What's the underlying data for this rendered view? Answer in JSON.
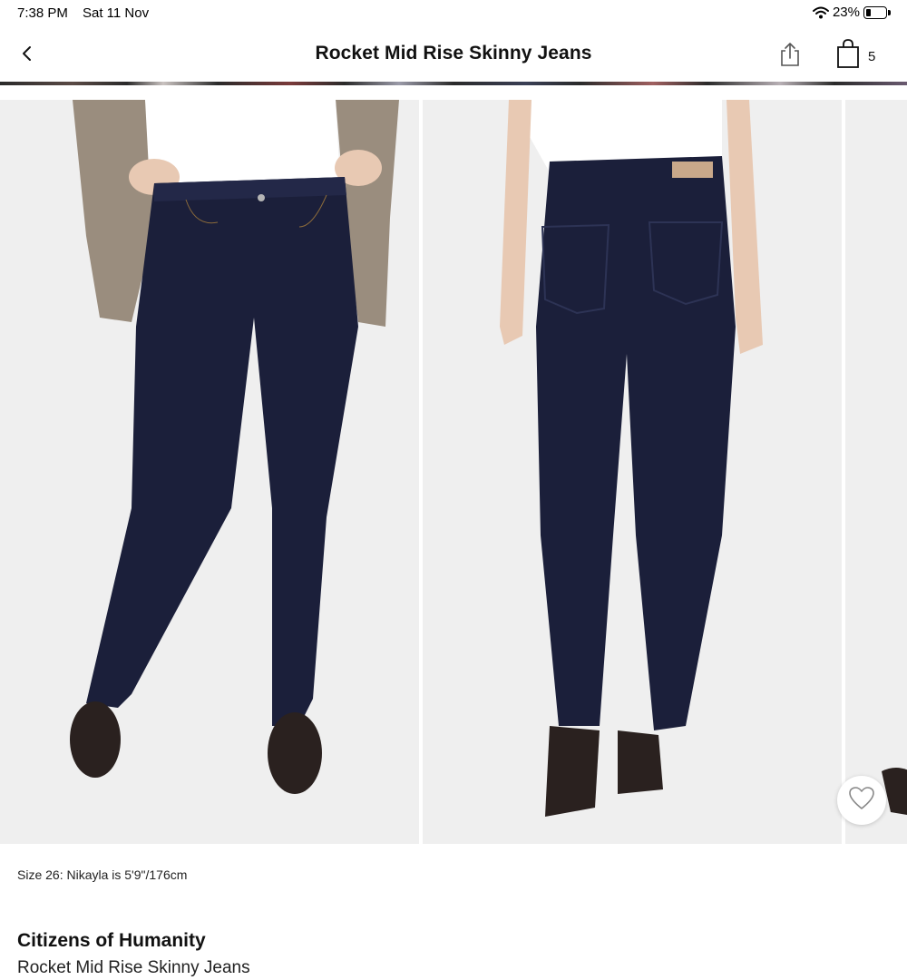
{
  "status_bar": {
    "time": "7:38 PM",
    "date": "Sat 11 Nov",
    "battery_percent": "23%",
    "battery_level": 0.23,
    "icons": [
      "wifi-icon",
      "battery-icon"
    ]
  },
  "nav": {
    "title": "Rocket Mid Rise Skinny Jeans",
    "bag_count": "5",
    "icons": [
      "chevron-left-icon",
      "share-icon",
      "shopping-bag-icon"
    ]
  },
  "gallery": {
    "images": [
      {
        "name": "front-view",
        "description_icon": "product-photo"
      },
      {
        "name": "back-view",
        "description_icon": "product-photo"
      },
      {
        "name": "next-view-partial",
        "description_icon": "product-photo"
      }
    ],
    "favorite_icon": "heart-outline-icon"
  },
  "product": {
    "model_info": "Size 26: Nikayla is 5'9\"/176cm",
    "brand": "Citizens of Humanity",
    "name": "Rocket Mid Rise Skinny Jeans"
  },
  "colors": {
    "denim": "#1b1f3a",
    "background": "#efefef",
    "text": "#111111"
  }
}
